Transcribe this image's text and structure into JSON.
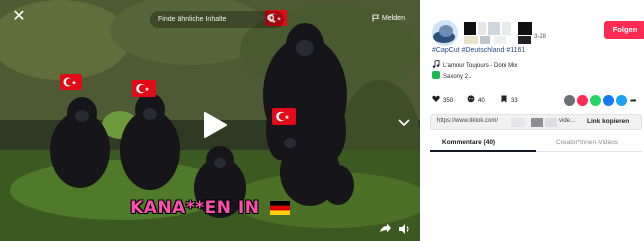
{
  "video": {
    "search_placeholder": "Finde ähnliche Inhalte",
    "report_label": "Melden",
    "caption_text": "KANA**EN IN"
  },
  "author": {
    "date_suffix": "3-28",
    "follow_label": "Folgen"
  },
  "description": {
    "hashtags": "#CapCut #Deutschland #1161"
  },
  "music": {
    "track": "L'amour Toujours - Doni Mix"
  },
  "effect": {
    "label": "Saxony",
    "count": "2"
  },
  "stats": {
    "likes": "350",
    "comments": "40",
    "saves": "33"
  },
  "share_link": {
    "url_start": "https://www.tiktok.com/",
    "url_end": "vide...",
    "copy_label": "Link kopieren"
  },
  "tabs": {
    "comments": "Kommentare (40)",
    "creator": "Creator*innen-Videos"
  },
  "colors": {
    "accent": "#fe2c55",
    "hashtag": "#2b4a8b",
    "flag_red": "#e30a17",
    "caption_pink": "#ff4fb0"
  },
  "icons": {
    "close": "close-icon",
    "search": "search-icon",
    "report": "flag-icon",
    "play": "play-icon",
    "music": "music-note-icon",
    "like": "heart-icon",
    "comment": "comment-icon",
    "save": "bookmark-icon"
  }
}
